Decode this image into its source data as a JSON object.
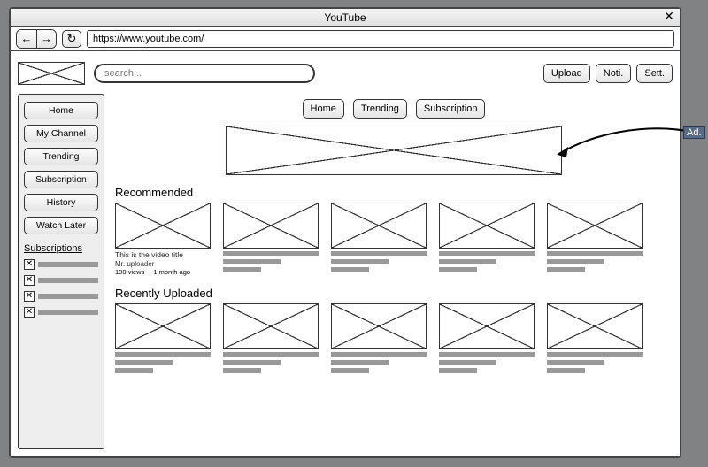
{
  "window": {
    "title": "YouTube",
    "url": "https://www.youtube.com/"
  },
  "search": {
    "placeholder": "search..."
  },
  "top_buttons": {
    "upload": "Upload",
    "notifications": "Noti.",
    "settings": "Sett."
  },
  "nav_tabs": [
    "Home",
    "Trending",
    "Subscription"
  ],
  "sidebar": {
    "items": [
      "Home",
      "My Channel",
      "Trending",
      "Subscription",
      "History",
      "Watch Later"
    ],
    "subs_heading": "Subscriptions"
  },
  "sections": {
    "recommended": {
      "title": "Recommended",
      "first_card": {
        "title": "This is the video title",
        "uploader": "Mr. uploader",
        "views": "100 views",
        "age": "1 month ago"
      }
    },
    "recent": {
      "title": "Recently Uploaded"
    }
  },
  "annotation": {
    "label": "Ad."
  }
}
